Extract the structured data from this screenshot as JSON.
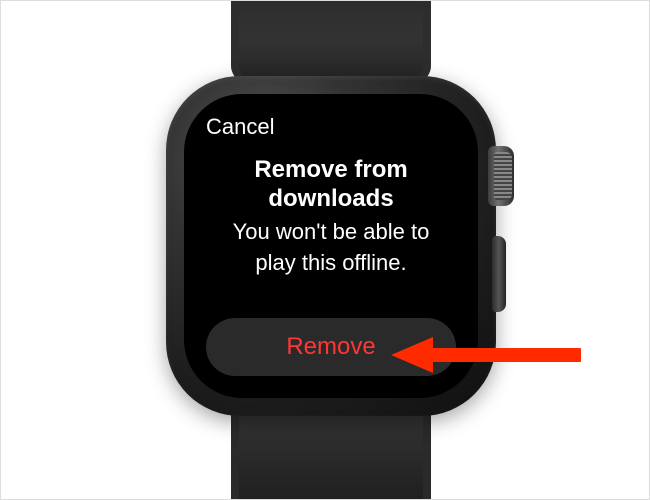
{
  "dialog": {
    "cancel_label": "Cancel",
    "title_line1": "Remove from",
    "title_line2": "downloads",
    "message_line1": "You won't be able to",
    "message_line2": "play this offline.",
    "remove_label": "Remove"
  },
  "colors": {
    "destructive": "#ff3636",
    "annotation": "#ff2a00"
  }
}
